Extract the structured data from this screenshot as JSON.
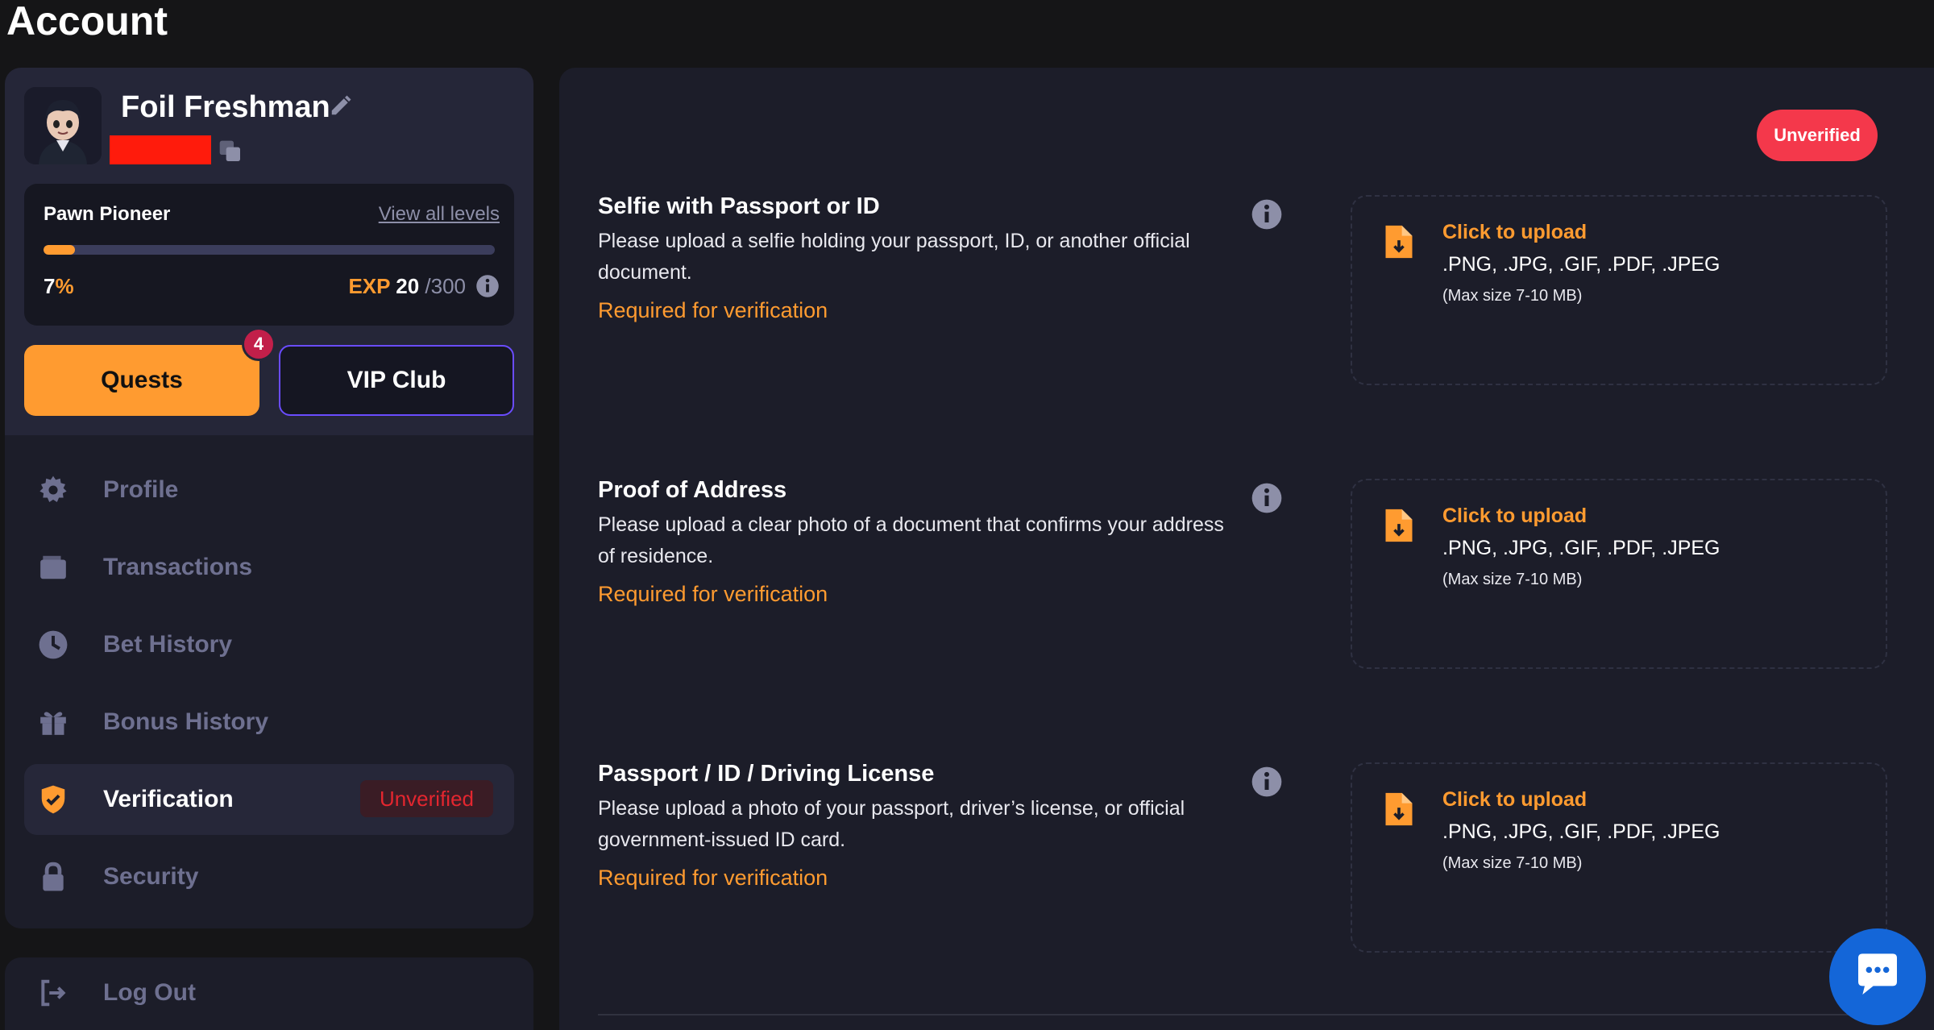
{
  "page": {
    "title": "Account"
  },
  "profile": {
    "username": "Foil Freshman",
    "level_name": "Pawn Pioneer",
    "view_levels_label": "View all levels",
    "progress_percent": 7,
    "progress_number": "7",
    "progress_symbol": "%",
    "exp_label": "EXP",
    "exp_current": "20",
    "exp_max": "/300"
  },
  "buttons": {
    "quests_label": "Quests",
    "quests_badge": "4",
    "vip_label": "VIP Club"
  },
  "nav": {
    "items": [
      {
        "label": "Profile",
        "icon": "gear-icon"
      },
      {
        "label": "Transactions",
        "icon": "wallet-icon"
      },
      {
        "label": "Bet History",
        "icon": "clock-icon"
      },
      {
        "label": "Bonus History",
        "icon": "gift-icon"
      },
      {
        "label": "Verification",
        "icon": "shield-check-icon",
        "active": true,
        "status": "Unverified"
      },
      {
        "label": "Security",
        "icon": "lock-icon"
      }
    ],
    "logout_label": "Log Out"
  },
  "verification": {
    "status": "Unverified",
    "sections": [
      {
        "title": "Selfie with Passport or ID",
        "description": "Please upload a selfie holding your passport, ID, or another official document.",
        "required": "Required for verification"
      },
      {
        "title": "Proof of Address",
        "description": "Please upload a clear photo of a document that confirms your address of residence.",
        "required": "Required for verification"
      },
      {
        "title": "Passport / ID / Driving License",
        "description": "Please upload a photo of your passport, driver’s license, or official government-issued ID card.",
        "required": "Required for verification"
      }
    ],
    "upload": {
      "click_label": "Click to upload",
      "types": ".PNG, .JPG, .GIF, .PDF, .JPEG",
      "max_size": "(Max size 7-10 MB)"
    }
  },
  "colors": {
    "accent": "#ff9b30",
    "danger": "#f4384b",
    "background": "#151517",
    "panel": "#1c1d29",
    "chat": "#1466d8"
  }
}
